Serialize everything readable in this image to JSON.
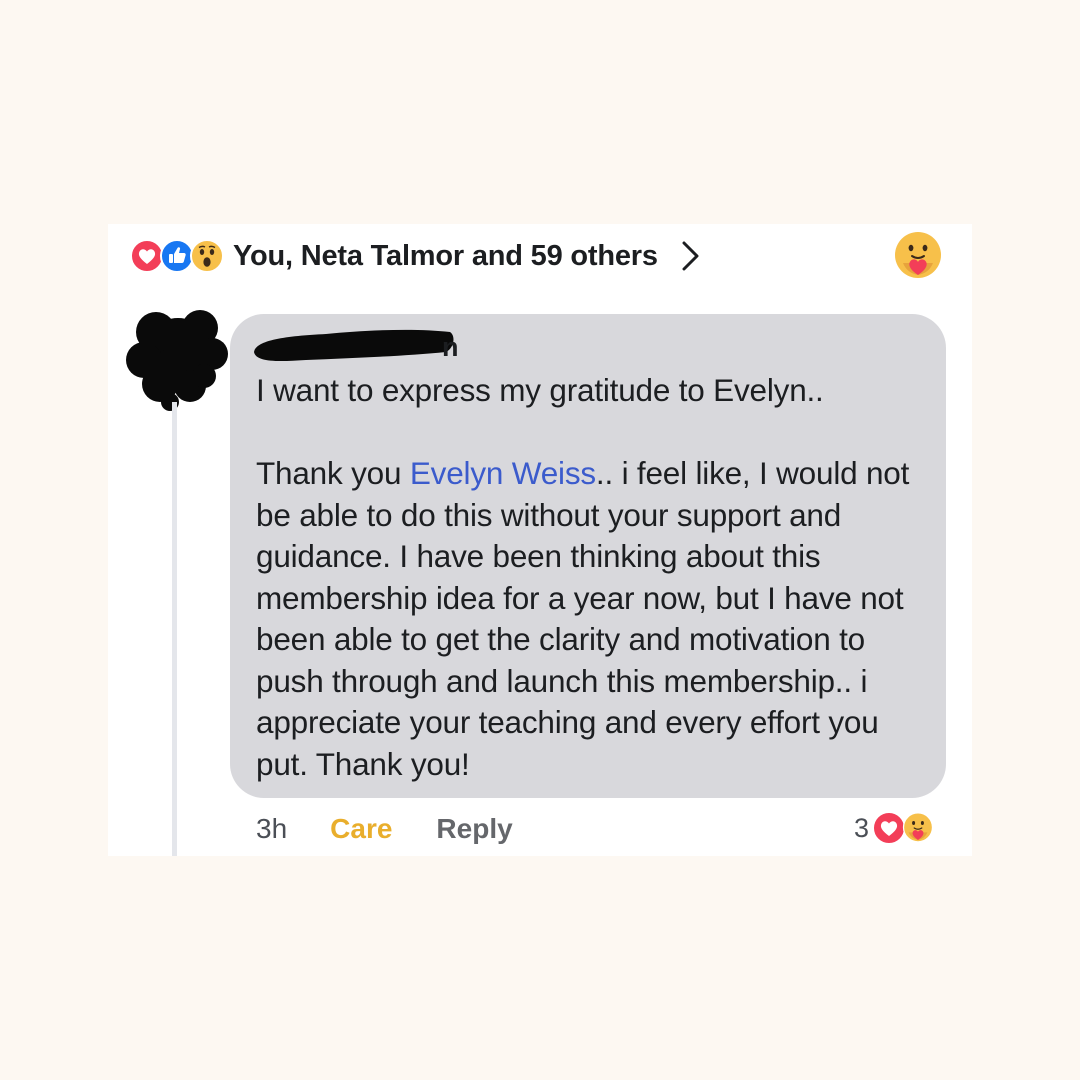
{
  "reactions_summary": {
    "icons": [
      "heart-reaction-icon",
      "like-reaction-icon",
      "wow-reaction-icon"
    ],
    "text": "You, Neta Talmor and 59 others",
    "chevron_icon": "chevron-right-icon"
  },
  "post_reaction": {
    "icon": "care-reaction-icon"
  },
  "comment": {
    "author_suffix": "n",
    "author_redacted": true,
    "line1": "I want to express my gratitude to Evelyn..",
    "p2_before": "Thank you ",
    "mention": "Evelyn Weiss",
    "p2_after": ".. i feel like, I would not be able to do this without your support and guidance. I have been thinking about this membership idea for a year now, but I have not been able to get the clarity and motivation to push through and launch this membership.. i appreciate your teaching and every effort you put. Thank you!",
    "timestamp": "3h",
    "care_label": "Care",
    "reply_label": "Reply",
    "reaction_count": "3",
    "reaction_icons": [
      "heart-reaction-icon",
      "care-reaction-icon"
    ]
  },
  "colors": {
    "page_background": "#fdf8f2",
    "card_background": "#ffffff",
    "bubble_background": "#d8d8dc",
    "mention": "#3b5bcc",
    "care": "#e9ae2c",
    "heart": "#f33e58",
    "like": "#1877f2",
    "emoji_yellow": "#f7c04a"
  }
}
